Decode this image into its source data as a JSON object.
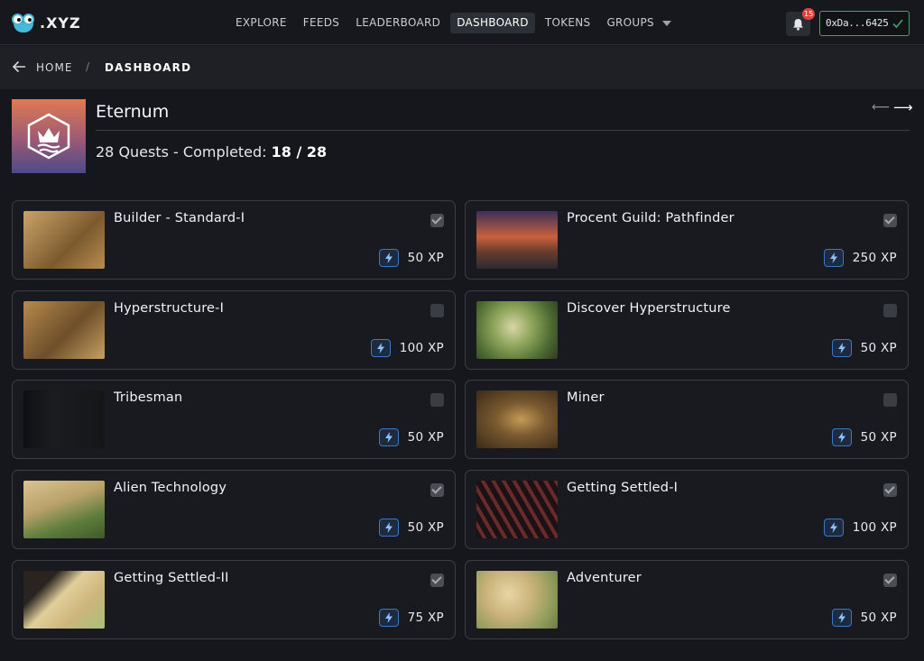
{
  "header": {
    "logo_text": ".XYZ",
    "nav": [
      "EXPLORE",
      "FEEDS",
      "LEADERBOARD",
      "DASHBOARD",
      "TOKENS",
      "GROUPS"
    ],
    "active_nav": "DASHBOARD",
    "notification_count": "15",
    "wallet": "0xDa...6425"
  },
  "breadcrumb": {
    "home": "HOME",
    "separator": "/",
    "current": "DASHBOARD"
  },
  "game": {
    "title": "Eternum",
    "quests_prefix": "28 Quests - Completed: ",
    "completed": "18",
    "slash": " / ",
    "total": "28"
  },
  "quests": [
    {
      "title": "Builder - Standard-I",
      "xp": "50 XP",
      "completed": true
    },
    {
      "title": "Procent Guild: Pathfinder",
      "xp": "250 XP",
      "completed": true
    },
    {
      "title": "Hyperstructure-I",
      "xp": "100 XP",
      "completed": false
    },
    {
      "title": "Discover Hyperstructure",
      "xp": "50 XP",
      "completed": false
    },
    {
      "title": "Tribesman",
      "xp": "50 XP",
      "completed": false
    },
    {
      "title": "Miner",
      "xp": "50 XP",
      "completed": false
    },
    {
      "title": "Alien Technology",
      "xp": "50 XP",
      "completed": true
    },
    {
      "title": "Getting Settled-I",
      "xp": "100 XP",
      "completed": true
    },
    {
      "title": "Getting Settled-II",
      "xp": "75 XP",
      "completed": true
    },
    {
      "title": "Adventurer",
      "xp": "50 XP",
      "completed": true
    }
  ],
  "colors": {
    "background": "#15171c",
    "card_border": "#3a3e46",
    "wallet_border": "#3aa66a",
    "xp_accent": "#3b78c4",
    "badge": "#e0413d"
  }
}
